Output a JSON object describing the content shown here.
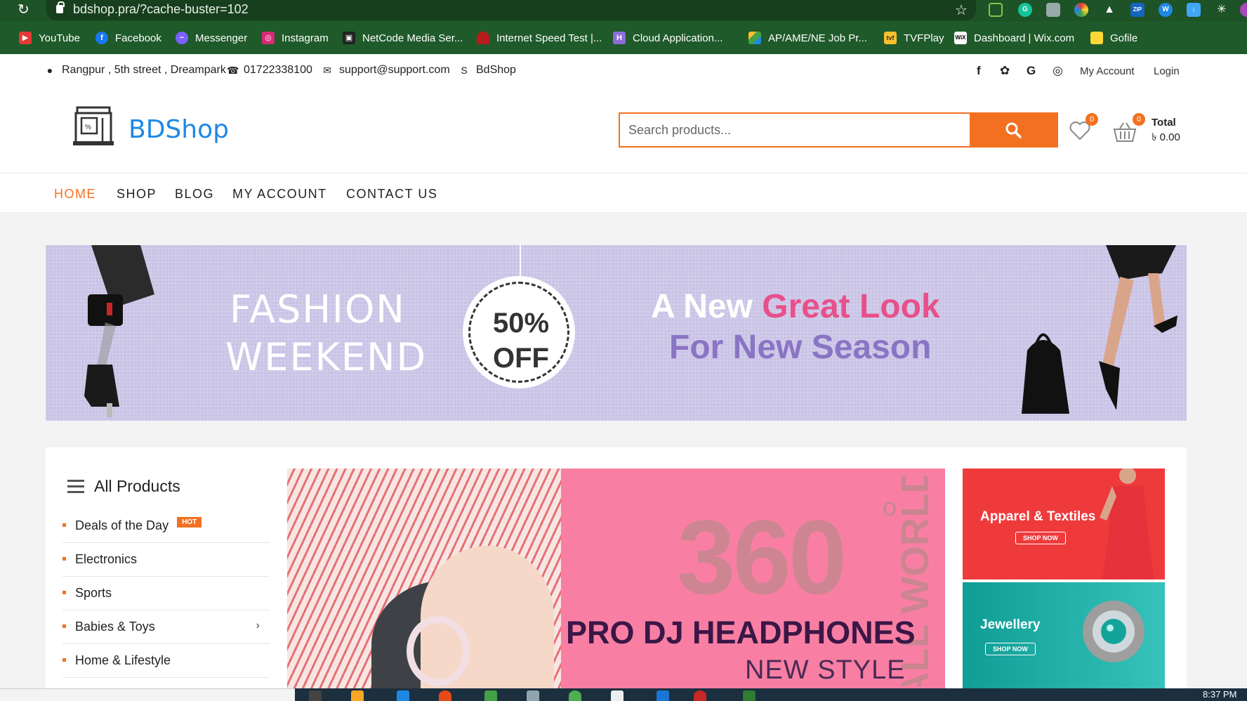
{
  "browser": {
    "url": "bdshop.pra/?cache-buster=102",
    "bookmarks": [
      {
        "label": "YouTube",
        "icon": "youtube-icon"
      },
      {
        "label": "Facebook",
        "icon": "facebook-icon"
      },
      {
        "label": "Messenger",
        "icon": "messenger-icon"
      },
      {
        "label": "Instagram",
        "icon": "instagram-icon"
      },
      {
        "label": "NetCode Media Ser...",
        "icon": "netcode-icon"
      },
      {
        "label": "Internet Speed Test |...",
        "icon": "speedtest-icon"
      },
      {
        "label": "Cloud Application...",
        "icon": "cloud-app-icon"
      },
      {
        "label": "AP/AME/NE Job Pr...",
        "icon": "drive-icon"
      },
      {
        "label": "TVFPlay",
        "icon": "tvf-icon"
      },
      {
        "label": "Dashboard | Wix.com",
        "icon": "wix-icon"
      },
      {
        "label": "Gofile",
        "icon": "gofile-icon"
      }
    ]
  },
  "topbar": {
    "address": "Rangpur , 5th street , Dreampark",
    "phone": "01722338100",
    "email": "support@support.com",
    "skype": "BdShop",
    "my_account": "My Account",
    "login": "Login"
  },
  "header": {
    "logo_text": "BDShop",
    "search_placeholder": "Search products...",
    "wishlist_count": "0",
    "cart_count": "0",
    "total_label": "Total",
    "total_value": "৳ 0.00"
  },
  "nav": {
    "items": [
      "HOME",
      "SHOP",
      "BLOG",
      "MY ACCOUNT",
      "CONTACT US"
    ],
    "active": "HOME"
  },
  "fashion_banner": {
    "line1": "FASHION",
    "line2": "WEEKEND",
    "discount_1": "50%",
    "discount_2": "OFF",
    "tag_a": "A New ",
    "tag_b": "Great Look",
    "tag_c": "For New Season"
  },
  "categories": {
    "title": "All Products",
    "hot_badge": "HOT",
    "items": [
      "Deals of the Day",
      "Electronics",
      "Sports",
      "Babies & Toys",
      "Home & Lifestyle"
    ]
  },
  "hero": {
    "big": "360",
    "deg": "o",
    "world": "ALL WORLD",
    "headline": "PRO DJ HEADPHONES",
    "sub": "NEW STYLE"
  },
  "promos": [
    {
      "title": "Apparel & Textiles",
      "button": "SHOP NOW"
    },
    {
      "title": "Jewellery",
      "button": "SHOP NOW"
    }
  ],
  "taskbar": {
    "clock": "8:37 PM"
  },
  "colors": {
    "accent": "#f37021",
    "logo_blue": "#1e88e5",
    "chrome_green": "#1f5a2a",
    "banner_lavender": "#c9c3e6",
    "hero_pink": "#f87fa3",
    "promo_red": "#ef3a3c",
    "promo_teal": "#14a39a"
  }
}
